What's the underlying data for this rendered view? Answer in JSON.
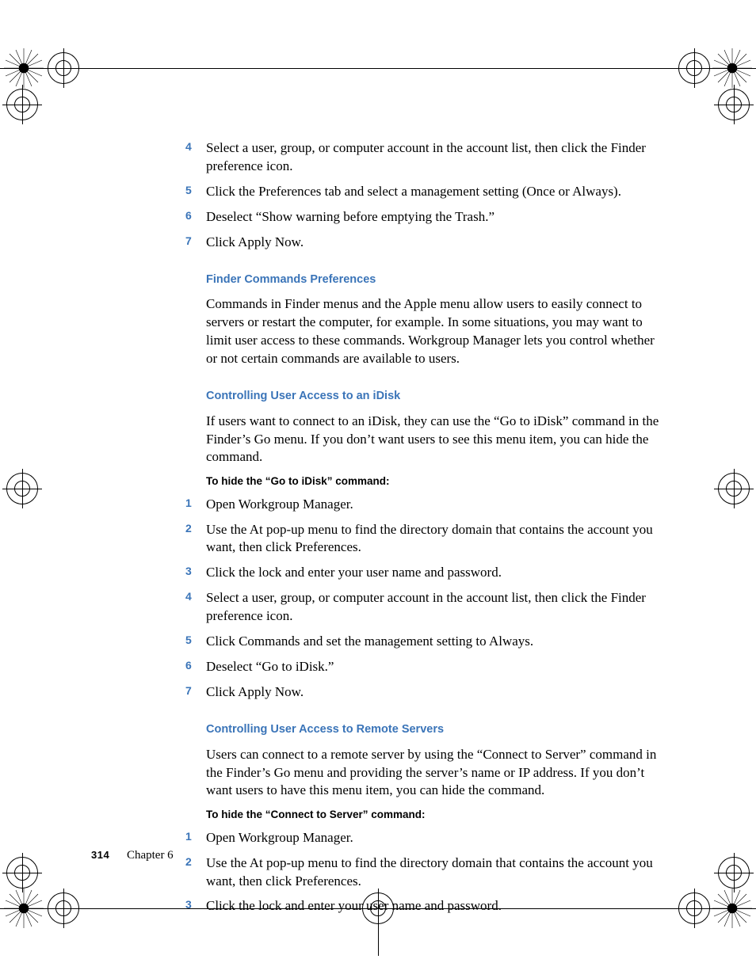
{
  "firstSteps": [
    {
      "n": "4",
      "t": "Select a user, group, or computer account in the account list, then click the Finder preference icon."
    },
    {
      "n": "5",
      "t": "Click the Preferences tab and select a management setting (Once or Always)."
    },
    {
      "n": "6",
      "t": "Deselect “Show warning before emptying the Trash.”"
    },
    {
      "n": "7",
      "t": "Click Apply Now."
    }
  ],
  "h1": "Finder Commands Preferences",
  "p1": "Commands in Finder menus and the Apple menu allow users to easily connect to servers or restart the computer, for example. In some situations, you may want to limit user access to these commands. Workgroup Manager lets you control whether or not certain commands are available to users.",
  "h2": "Controlling User Access to an iDisk",
  "p2": "If users want to connect to an iDisk, they can use the “Go to iDisk” command in the Finder’s Go menu. If you don’t want users to see this menu item, you can hide the command.",
  "sh1": "To hide the “Go to iDisk” command:",
  "steps2": [
    {
      "n": "1",
      "t": "Open Workgroup Manager."
    },
    {
      "n": "2",
      "t": "Use the At pop-up menu to find the directory domain that contains the account you want, then click Preferences."
    },
    {
      "n": "3",
      "t": "Click the lock and enter your user name and password."
    },
    {
      "n": "4",
      "t": "Select a user, group, or computer account in the account list, then click the Finder preference icon."
    },
    {
      "n": "5",
      "t": "Click Commands and set the management setting to Always."
    },
    {
      "n": "6",
      "t": "Deselect “Go to iDisk.”"
    },
    {
      "n": "7",
      "t": "Click Apply Now."
    }
  ],
  "h3": "Controlling User Access to Remote Servers",
  "p3": "Users can connect to a remote server by using the “Connect to Server” command in the Finder’s Go menu and providing the server’s name or IP address. If you don’t want users to have this menu item, you can hide the command.",
  "sh2": "To hide the “Connect to Server” command:",
  "steps3": [
    {
      "n": "1",
      "t": "Open Workgroup Manager."
    },
    {
      "n": "2",
      "t": "Use the At pop-up menu to find the directory domain that contains the account you want, then click Preferences."
    },
    {
      "n": "3",
      "t": "Click the lock and enter your user name and password."
    }
  ],
  "footer": {
    "page": "314",
    "chapter": "Chapter  6"
  }
}
